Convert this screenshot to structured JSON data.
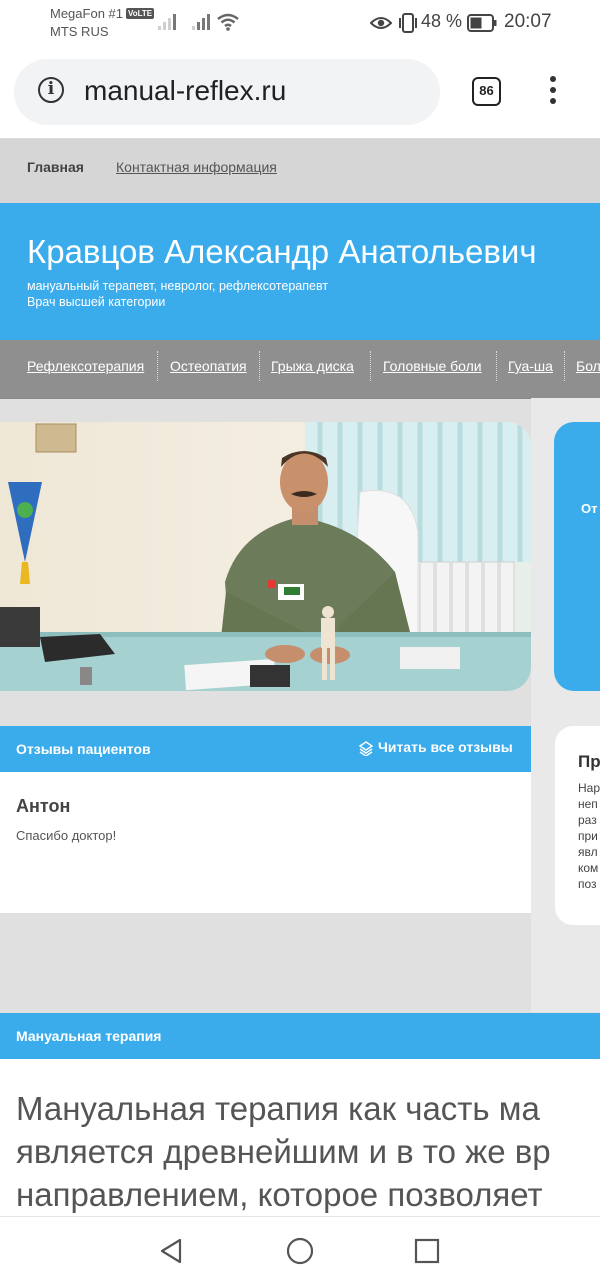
{
  "status_bar": {
    "operator1": "MegaFon #1",
    "volte": "VoLTE",
    "operator2": "MTS RUS",
    "battery": "48 %",
    "time": "20:07"
  },
  "browser": {
    "url": "manual-reflex.ru",
    "tab_count": "86"
  },
  "top_nav": {
    "home": "Главная",
    "contacts": "Контактная информация"
  },
  "header": {
    "title": "Кравцов Александр Анатольевич",
    "subtitle": "мануальный терапевт, невролог, рефлексотерапевт",
    "category": "Врач высшей категории"
  },
  "menu": {
    "items": [
      "Рефлексотерапия",
      "Остеопатия",
      "Грыжа диска",
      "Головные боли",
      "Гуа-ша",
      "Бол"
    ]
  },
  "promo": {
    "text": "От"
  },
  "reviews": {
    "title": "Отзывы пациентов",
    "read_all": "Читать все отзывы",
    "author": "Антон",
    "text": "Спасибо доктор!"
  },
  "side_card": {
    "title": "Пр",
    "lines": [
      "Нар",
      "неп",
      "раз",
      "при",
      "явл",
      "ком",
      "поз"
    ]
  },
  "manual_therapy": {
    "title": "Мануальная терапия",
    "lines": [
      "Мануальная терапия как часть ма",
      "является древнейшим и в то же вр",
      "направлением, которое позволяет"
    ]
  },
  "colors": {
    "accent": "#3aacec",
    "menu_bg": "#8f8f8f"
  }
}
